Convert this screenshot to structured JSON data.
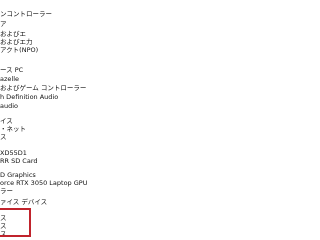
{
  "tree": {
    "lines": [
      "ンコントローラー",
      "ア",
      "およびエ",
      "およびエ力",
      "アクト(NPO)",
      "",
      "",
      "ース PC",
      "azelle",
      "およびゲーム コントローラー",
      "h Definition Audio",
      "audio",
      "",
      "イス",
      "・ネット",
      "ス",
      "",
      "XD55D1",
      "RR SD Card",
      "",
      "D Graphics",
      "orce RTX 3050 Laptop GPU",
      "ラー",
      "",
      "ァイス デバイス",
      "",
      "",
      "",
      "",
      "ス",
      "ス",
      "ス"
    ]
  },
  "highlight": {
    "color": "#c0232c"
  }
}
